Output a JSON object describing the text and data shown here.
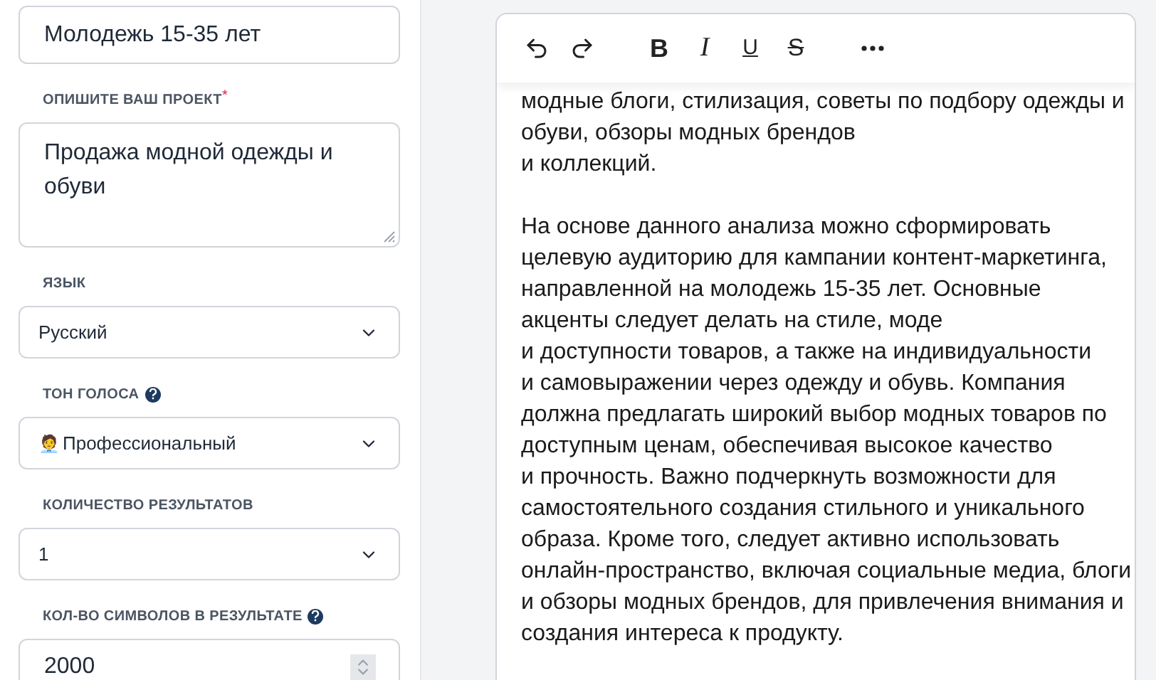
{
  "form": {
    "fields": [
      {
        "kind": "input",
        "value": "Молодежь 15-35 лет"
      },
      {
        "kind": "textarea",
        "label": "ОПИШИТЕ ВАШ ПРОЕКТ",
        "required_mark": "*",
        "value": "Продажа модной одежды и обуви"
      },
      {
        "kind": "select",
        "label": "ЯЗЫК",
        "value": "Русский"
      },
      {
        "kind": "select",
        "label": "ТОН ГОЛОСА",
        "help": true,
        "emoji": "🧑‍💼",
        "value": "Профессиональный"
      },
      {
        "kind": "select",
        "label": "КОЛИЧЕСТВО РЕЗУЛЬТАТОВ",
        "value": "1"
      },
      {
        "kind": "number",
        "label": "КОЛ-ВО СИМВОЛОВ В РЕЗУЛЬТАТЕ",
        "help": true,
        "value": "2000"
      }
    ]
  },
  "editor": {
    "toolbar": [
      {
        "kind": "undo"
      },
      {
        "kind": "redo"
      },
      {
        "kind": "gap"
      },
      {
        "kind": "bold",
        "label": "B"
      },
      {
        "kind": "italic",
        "label": "I"
      },
      {
        "kind": "underline",
        "label": "U"
      },
      {
        "kind": "strike",
        "label": "S"
      },
      {
        "kind": "gap"
      },
      {
        "kind": "more"
      }
    ],
    "paragraphs": [
      "модные блоги, стилизация, советы по подбору одежды и обуви, обзоры модных брендов\nи коллекций.",
      "На основе данного анализа можно сформировать целевую аудиторию для кампании контент-маркетинга, направленной на молодежь 15-35 лет. Основные акценты следует делать на стиле, моде\nи доступности товаров, а также на индивидуальности\nи самовыражении через одежду и обувь. Компания должна предлагать широкий выбор модных товаров по доступным ценам, обеспечивая высокое качество\nи прочность. Важно подчеркнуть возможности для самостоятельного создания стильного и уникального образа. Кроме того, следует активно использовать онлайн-пространство, включая социальные медиа, блоги и обзоры модных брендов, для привлечения внимания и создания интереса к продукту."
    ]
  }
}
